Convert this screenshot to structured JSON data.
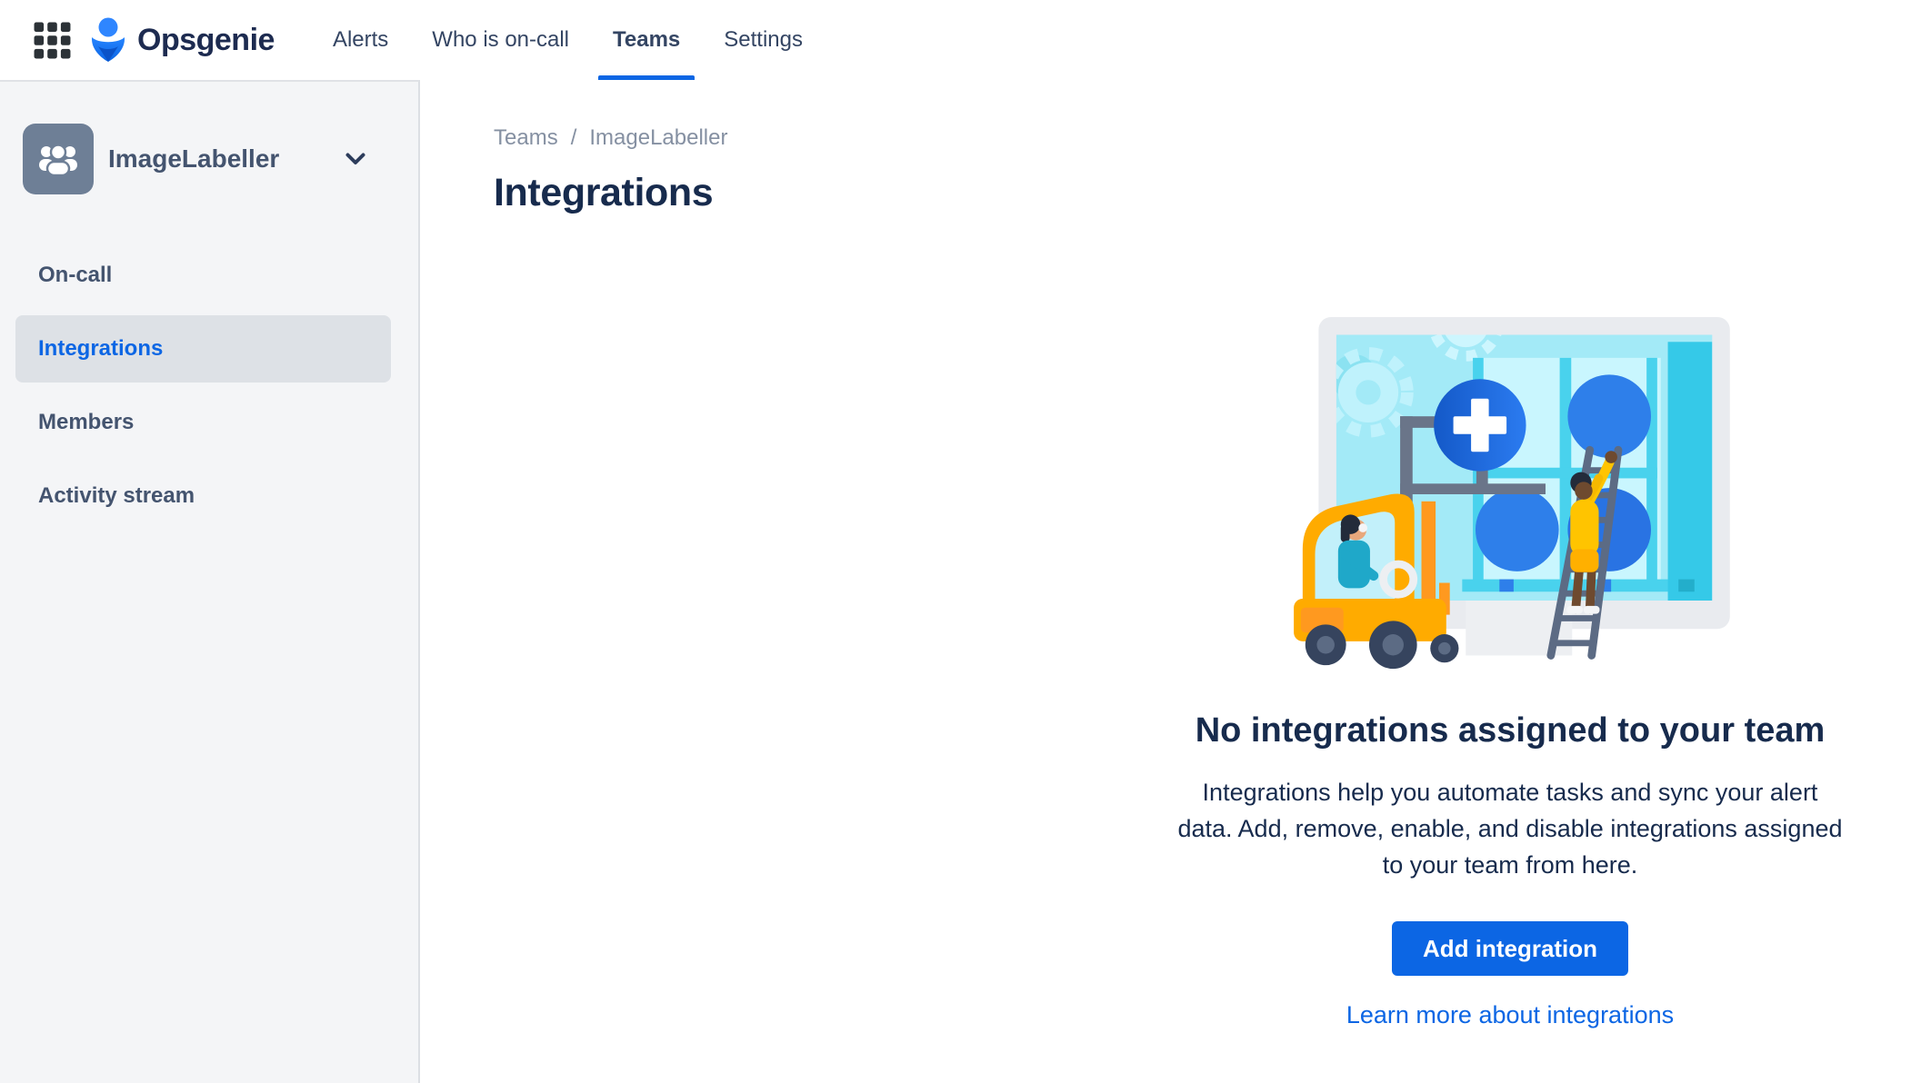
{
  "topbar": {
    "product_name": "Opsgenie",
    "nav": [
      {
        "label": "Alerts",
        "active": false
      },
      {
        "label": "Who is on-call",
        "active": false
      },
      {
        "label": "Teams",
        "active": true
      },
      {
        "label": "Settings",
        "active": false
      }
    ]
  },
  "sidebar": {
    "team_name": "ImageLabeller",
    "items": [
      {
        "label": "On-call",
        "active": false
      },
      {
        "label": "Integrations",
        "active": true
      },
      {
        "label": "Members",
        "active": false
      },
      {
        "label": "Activity stream",
        "active": false
      }
    ]
  },
  "main": {
    "breadcrumb": [
      "Teams",
      "ImageLabeller"
    ],
    "breadcrumb_separator": "/",
    "page_title": "Integrations",
    "empty_state": {
      "title": "No integrations assigned to your team",
      "description_lines": [
        "Integrations help you automate tasks and sync your alert",
        "data. Add, remove, enable, and disable integrations assigned",
        "to your team from here."
      ],
      "add_button_label": "Add integration",
      "learn_more_label": "Learn more about integrations"
    }
  },
  "colors": {
    "brand_blue": "#0C66E4",
    "active_tab_underline": "#0C66E4",
    "sidebar_background": "#F4F5F7",
    "sidebar_selected_background": "#DDE1E6",
    "sidebar_text": "#44546F",
    "team_avatar_background": "#6E7F96",
    "breadcrumb_gray": "#8590A2",
    "heading_dark": "#172B4D",
    "button_text": "#FFFFFF"
  }
}
